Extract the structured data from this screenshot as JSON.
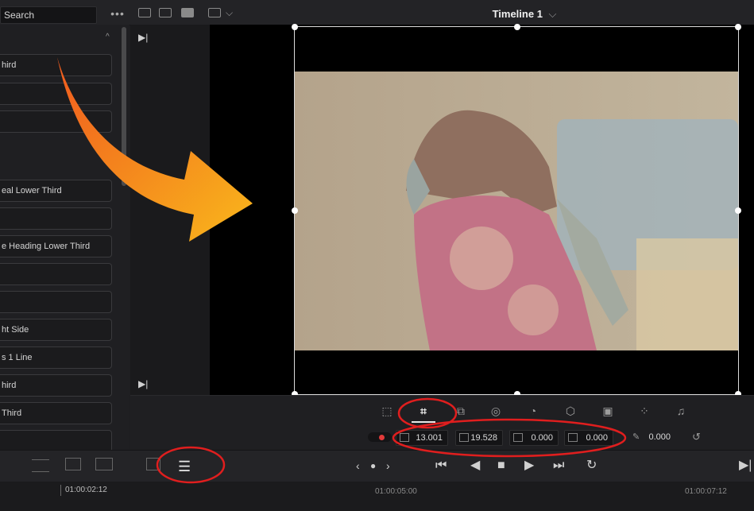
{
  "topbar": {
    "search_placeholder": "Search",
    "more_label": "•••",
    "timeline_title": "Timeline 1",
    "timeline_chevron": "⌵"
  },
  "left_panel": {
    "items": [
      {
        "label": "hird"
      },
      {
        "label": ""
      },
      {
        "label": ""
      },
      {
        "label": "eal Lower Third"
      },
      {
        "label": ""
      },
      {
        "label": "e Heading Lower Third"
      },
      {
        "label": ""
      },
      {
        "label": ""
      },
      {
        "label": "ht Side"
      },
      {
        "label": "s 1 Line"
      },
      {
        "label": "hird"
      },
      {
        "label": "Third"
      },
      {
        "label": ""
      }
    ]
  },
  "params": {
    "p1": "13.001",
    "p2": "19.528",
    "p3": "0.000",
    "p4": "0.000",
    "p5": "0.000"
  },
  "timeline": {
    "tc_left": "01:00:02:12",
    "tc_mid": "01:00:05:00",
    "tc_right": "01:00:07:12"
  },
  "colors": {
    "accent_arrow": "#f7a21b",
    "annotation_red": "#e01e1e"
  }
}
